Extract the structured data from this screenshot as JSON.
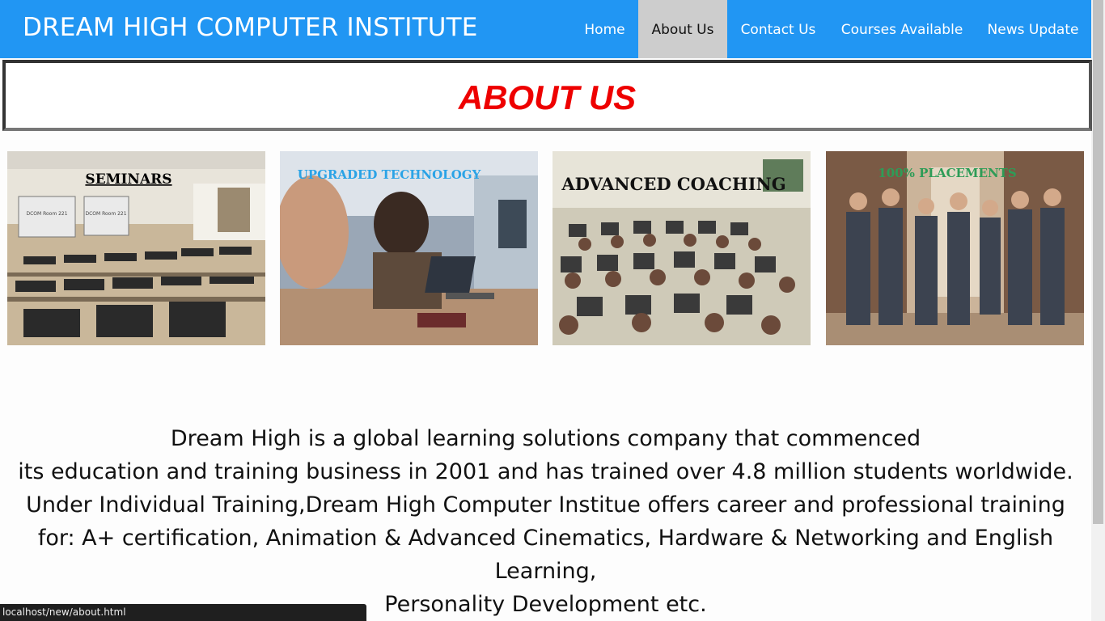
{
  "brand": "DREAM HIGH COMPUTER INSTITUTE",
  "nav": {
    "items": [
      {
        "label": "Home"
      },
      {
        "label": "About Us"
      },
      {
        "label": "Contact Us"
      },
      {
        "label": "Courses Available"
      },
      {
        "label": "News Update"
      }
    ],
    "active": "About Us"
  },
  "page_title": "ABOUT US",
  "features": [
    {
      "caption": "SEMINARS",
      "room_sign_1": "DCOM Room 221",
      "room_sign_2": "DCOM Room 221"
    },
    {
      "caption": "UPGRADED TECHNOLOGY"
    },
    {
      "caption": "ADVANCED COACHING"
    },
    {
      "caption": "100% PLACEMENTS"
    }
  ],
  "about_lines": [
    "Dream High is a global learning solutions company that commenced",
    "its education and training business in 2001 and has trained over 4.8 million students worldwide.",
    "Under Individual Training,Dream High Computer Institue offers career and professional training",
    "for: A+ certification, Animation & Advanced Cinematics, Hardware & Networking and English",
    "Learning,",
    "Personality Development etc."
  ],
  "status_url": "localhost/new/about.html",
  "colors": {
    "navbar": "#2196f3",
    "active_tab": "#cdcdcd",
    "title_red": "#ee0000"
  }
}
